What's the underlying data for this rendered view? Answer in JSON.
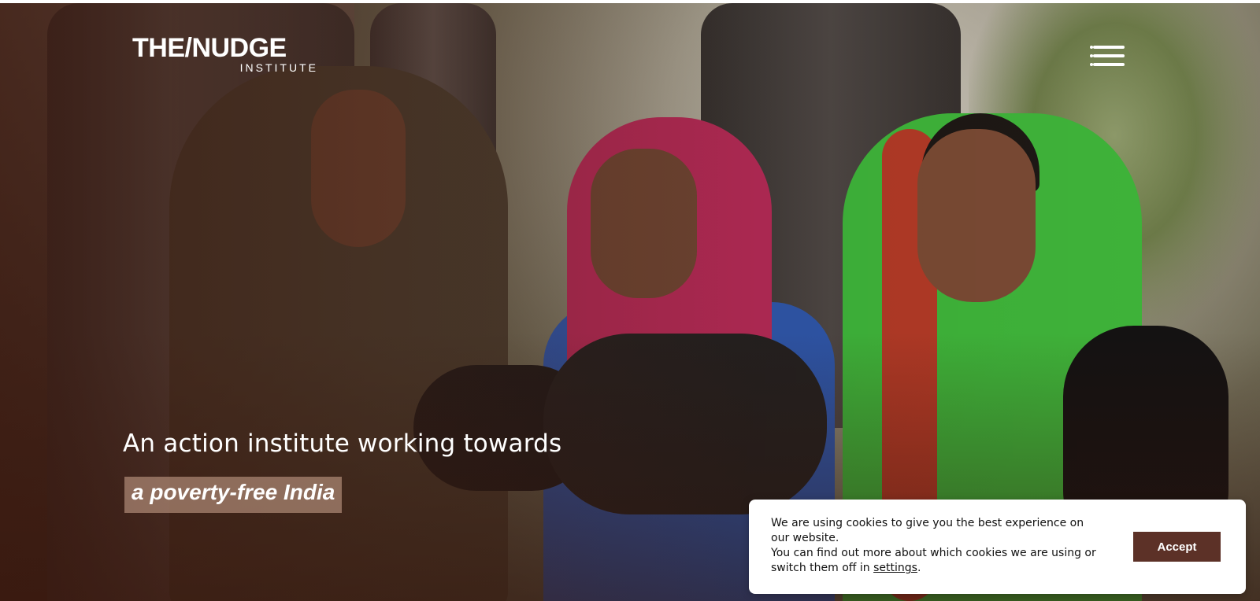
{
  "header": {
    "logo_main": "THE/NUDGE",
    "logo_sub": "INSTITUTE",
    "menu_icon": "hamburger-menu-icon"
  },
  "hero": {
    "headline": "An action institute working towards",
    "tagline": "a poverty-free India",
    "image_description_icon": "hero-photo"
  },
  "cookie_notice": {
    "line1": "We are using cookies to give you the best experience on our website.",
    "line2_prefix": "You can find out more about which cookies we are using or switch them off in ",
    "settings_link": "settings",
    "line2_suffix": ".",
    "accept_label": "Accept"
  },
  "colors": {
    "accent": "#5c3127",
    "tagline_bg": "#b08c78"
  }
}
